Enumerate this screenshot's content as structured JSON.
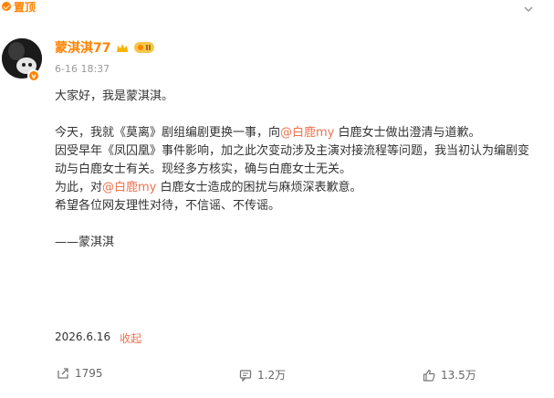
{
  "pinned_label": "置顶",
  "user": {
    "name": "蒙淇淇77",
    "level_badge": "II",
    "verified": "v",
    "time": "6-16 18:37"
  },
  "post": {
    "line1": "大家好，我是蒙淇淇。",
    "para2_a": "今天，我就《莫离》剧组编剧更换一事，向",
    "mention1": "@白鹿my",
    "para2_b": "白鹿女士做出澄清与道歉。",
    "para3": "因受早年《凤囚凰》事件影响，加之此次变动涉及主演对接流程等问题，我当初认为编剧变动与白鹿女士有关。现经多方核实，确与白鹿女士无关。",
    "para4_a": "为此，对",
    "mention2": "@白鹿my",
    "para4_b": "白鹿女士造成的困扰与麻烦深表歉意。",
    "para5": "希望各位网友理性对待，不信谣、不传谣。",
    "signature": "——蒙淇淇"
  },
  "footer": {
    "date": "2026.6.16",
    "collapse_label": "收起"
  },
  "actions": {
    "repost_count": "1795",
    "comment_count": "1.2万",
    "like_count": "13.5万"
  },
  "colors": {
    "accent": "#ff8200",
    "mention": "#eb7350"
  }
}
